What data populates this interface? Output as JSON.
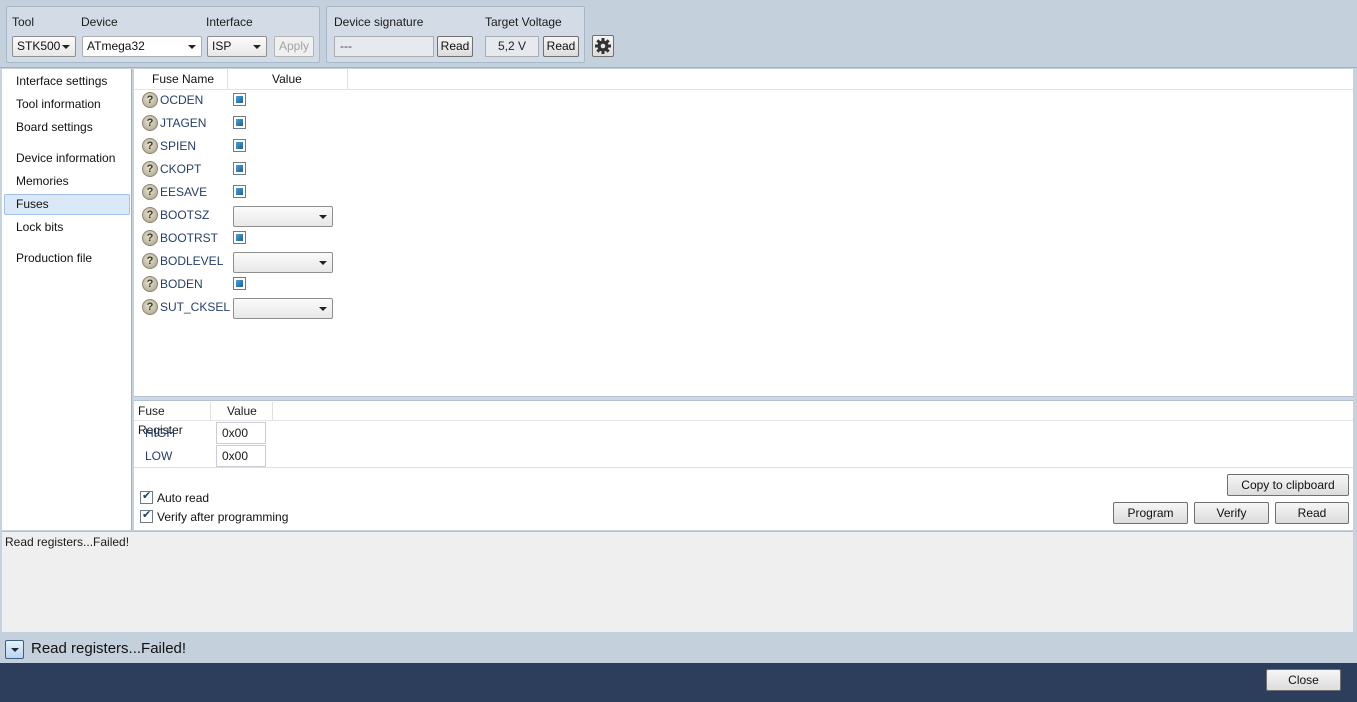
{
  "toolbar": {
    "tool": {
      "label": "Tool",
      "value": "STK500"
    },
    "device": {
      "label": "Device",
      "value": "ATmega32"
    },
    "interface": {
      "label": "Interface",
      "value": "ISP"
    },
    "apply_label": "Apply",
    "device_signature": {
      "label": "Device signature",
      "value": "---",
      "read_label": "Read"
    },
    "target_voltage": {
      "label": "Target Voltage",
      "value": "5,2 V",
      "read_label": "Read"
    },
    "settings_icon": "gear-icon"
  },
  "sidebar": {
    "items": [
      {
        "label": "Interface settings"
      },
      {
        "label": "Tool information"
      },
      {
        "label": "Board settings"
      },
      {
        "label": "Device information"
      },
      {
        "label": "Memories"
      },
      {
        "label": "Fuses",
        "active": true
      },
      {
        "label": "Lock bits"
      },
      {
        "label": "Production file"
      }
    ]
  },
  "fuses": {
    "columns": {
      "name": "Fuse Name",
      "value": "Value"
    },
    "help_glyph": "?",
    "rows": [
      {
        "name": "OCDEN",
        "type": "checkbox"
      },
      {
        "name": "JTAGEN",
        "type": "checkbox"
      },
      {
        "name": "SPIEN",
        "type": "checkbox"
      },
      {
        "name": "CKOPT",
        "type": "checkbox"
      },
      {
        "name": "EESAVE",
        "type": "checkbox"
      },
      {
        "name": "BOOTSZ",
        "type": "select"
      },
      {
        "name": "BOOTRST",
        "type": "checkbox"
      },
      {
        "name": "BODLEVEL",
        "type": "select"
      },
      {
        "name": "BODEN",
        "type": "checkbox"
      },
      {
        "name": "SUT_CKSEL",
        "type": "select"
      }
    ]
  },
  "registers": {
    "columns": {
      "name": "Fuse Register",
      "value": "Value"
    },
    "rows": [
      {
        "name": "HIGH",
        "value": "0x00"
      },
      {
        "name": "LOW",
        "value": "0x00"
      }
    ]
  },
  "options": {
    "auto_read": {
      "label": "Auto read",
      "checked": true
    },
    "verify_after_programming": {
      "label": "Verify after programming",
      "checked": true
    }
  },
  "actions": {
    "copy_label": "Copy to clipboard",
    "program_label": "Program",
    "verify_label": "Verify",
    "read_label": "Read"
  },
  "log": {
    "text": "Read registers...Failed!"
  },
  "status": {
    "text": "Read registers...Failed!"
  },
  "footer": {
    "close_label": "Close"
  }
}
